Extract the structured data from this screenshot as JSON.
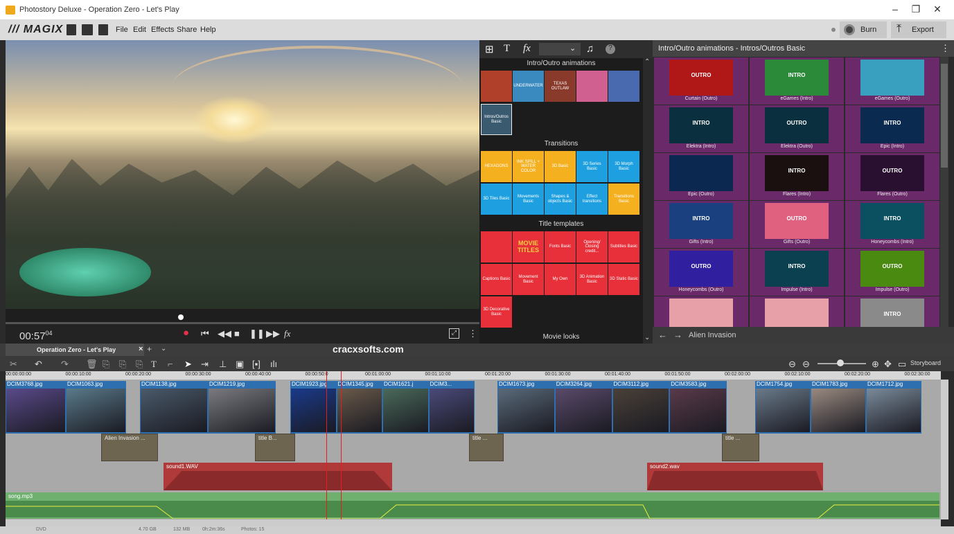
{
  "window": {
    "title": "Photostory Deluxe - Operation Zero - Let's Play",
    "minimize": "–",
    "maximize": "❐",
    "close": "✕"
  },
  "menubar": {
    "logo": "/// MAGIX",
    "items": [
      "File",
      "Edit",
      "Effects",
      "Share",
      "Help"
    ],
    "burn_label": "Burn",
    "export_label": "Export"
  },
  "preview": {
    "timecode": "00:57",
    "timecode_frames": "04",
    "scrub_position": 0.37
  },
  "fxpanel": {
    "sections": [
      {
        "title": "Intro/Outro animations",
        "items": [
          "",
          "UNDERWATER",
          "TEXAS OUTLAW",
          "",
          "",
          "Intros/Outros Basic"
        ]
      },
      {
        "title": "Transitions",
        "items": [
          "HEXAGONS",
          "INK SPILL + WATER COLOR",
          "3D Basic",
          "3D Series Basic",
          "3D Morph Basic",
          "3D Tiles Basic",
          "Movements Basic",
          "Shapes & objects Basic",
          "Effect transitions",
          "Transitions Basic"
        ]
      },
      {
        "title": "Title templates",
        "items": [
          "",
          "MOVIE TITLES",
          "Fonts Basic",
          "Opening/ Closing credit...",
          "Subtitles Basic",
          "Captions Basic",
          "Movement Basic",
          "My Own",
          "3D Animation Basic",
          "3D Static Basic",
          "3D Decorative Basic"
        ]
      },
      {
        "title": "Movie looks",
        "items": []
      }
    ]
  },
  "animpanel": {
    "title": "Intro/Outro animations - Intros/Outros Basic",
    "items": [
      {
        "label": "Curtain (Outro)",
        "text": "OUTRO",
        "color": "#b01818"
      },
      {
        "label": "eGames (Intro)",
        "text": "INTRO",
        "color": "#2a8a3a"
      },
      {
        "label": "eGames (Outro)",
        "text": "",
        "color": "#3aa0c0"
      },
      {
        "label": "Elektra (Intro)",
        "text": "INTRO",
        "color": "#0a3040"
      },
      {
        "label": "Elektra (Outro)",
        "text": "OUTRO",
        "color": "#0a3040"
      },
      {
        "label": "Epic (Intro)",
        "text": "INTRO",
        "color": "#0a2a50"
      },
      {
        "label": "Epic (Outro)",
        "text": "",
        "color": "#0a2850"
      },
      {
        "label": "Flares (Intro)",
        "text": "INTRO",
        "color": "#1a1010"
      },
      {
        "label": "Flares (Outro)",
        "text": "OUTRO",
        "color": "#2a1030"
      },
      {
        "label": "Gifts (Intro)",
        "text": "INTRO",
        "color": "#1a4080"
      },
      {
        "label": "Gifts (Outro)",
        "text": "OUTRO",
        "color": "#e06080"
      },
      {
        "label": "Honeycombs (Intro)",
        "text": "INTRO",
        "color": "#0a5060"
      },
      {
        "label": "Honeycombs (Outro)",
        "text": "OUTRO",
        "color": "#3020a0"
      },
      {
        "label": "Impulse (Intro)",
        "text": "INTRO",
        "color": "#0a4050"
      },
      {
        "label": "Impulse (Outro)",
        "text": "OUTRO",
        "color": "#4a8a10"
      },
      {
        "label": "",
        "text": "",
        "color": "#e8a0a8"
      },
      {
        "label": "",
        "text": "",
        "color": "#e8a0a8"
      },
      {
        "label": "",
        "text": "INTRO",
        "color": "#8a8a8a"
      }
    ],
    "nav_label": "Alien Invasion"
  },
  "timeline": {
    "tab_title": "Operation Zero - Let's Play",
    "watermark": "cracxsofts.com",
    "storyboard_label": "Storyboard",
    "ruler": [
      "00:00:00:00",
      "00:00:10:00",
      "00:00:20:00",
      "00:00:30:00",
      "00:00:40:00",
      "00:00:50:0",
      "00:01:00:00",
      "00:01:10:00",
      "00:01:20:00",
      "00:01:30:00",
      "00:01:40:00",
      "00:01:50:00",
      "00:02:00:00",
      "00:02:10:00",
      "00:02:20:00",
      "00:02:30:00"
    ],
    "photo_clips": [
      {
        "label": "DCIM3768.jpg",
        "color": "#5a4a8a"
      },
      {
        "label": "DCIM1063.jpg",
        "color": "#5a7a8a"
      },
      {
        "label": "DCIM1138.jpg",
        "color": "#4a5a6a"
      },
      {
        "label": "DCIM1219.jpg",
        "color": "#7a7a80"
      },
      {
        "label": "DCIM1923.jpg",
        "color": "#1a3a8a"
      },
      {
        "label": "DCIM1345.jpg",
        "color": "#6a5a4a"
      },
      {
        "label": "DCIM1621.j",
        "color": "#4a6a5a"
      },
      {
        "label": "DCIM3...",
        "color": "#4a4a7a"
      },
      {
        "label": "DCIM1673.jpg",
        "color": "#5a6a7a"
      },
      {
        "label": "DCIM3264.jpg",
        "color": "#5a4a6a"
      },
      {
        "label": "DCIM3112.jpg",
        "color": "#4a4038"
      },
      {
        "label": "DCIM3583.jpg",
        "color": "#5a3a4a"
      },
      {
        "label": "DCIM1754.jpg",
        "color": "#6a7a8a"
      },
      {
        "label": "DCIM1783.jpg",
        "color": "#9a8a80"
      },
      {
        "label": "DCIM1712.jpg",
        "color": "#7a8a9a"
      }
    ],
    "title_clips": [
      "Alien Invasion ...",
      "title   B...",
      "title   ...",
      "title   ..."
    ],
    "audio_clips": [
      "sound1.WAV",
      "sound2.wav"
    ],
    "music_track": "song.mp3"
  },
  "statusbar": {
    "items": [
      "DVD",
      "4.70 GB",
      "132 MB",
      "0h:2m:36s",
      "Photos: 15"
    ]
  }
}
